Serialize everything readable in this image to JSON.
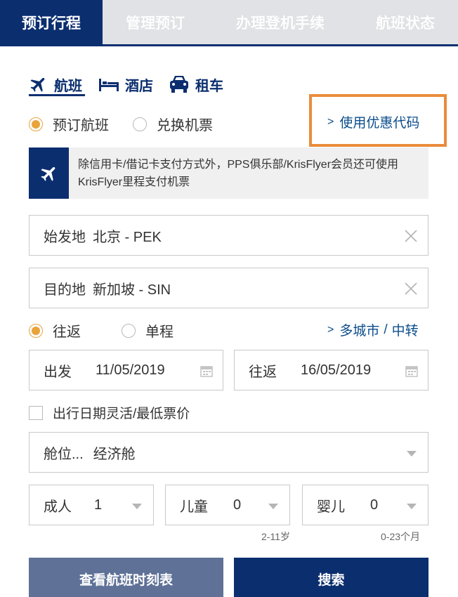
{
  "topnav": {
    "tabs": [
      {
        "label": "预订行程"
      },
      {
        "label": "管理预订"
      },
      {
        "label": "办理登机手续"
      },
      {
        "label": "航班状态"
      }
    ]
  },
  "products": {
    "flights": "航班",
    "hotels": "酒店",
    "cars": "租车"
  },
  "mode": {
    "book": "预订航班",
    "redeem": "兑换机票",
    "selected": "预订航班"
  },
  "promo": {
    "label": "使用优惠代码"
  },
  "info": {
    "text": "除信用卡/借记卡支付方式外，PPS俱乐部/KrisFlyer会员还可使用KrisFlyer里程支付机票"
  },
  "origin": {
    "label": "始发地",
    "value": "北京 - PEK"
  },
  "destination": {
    "label": "目的地",
    "value": "新加坡 - SIN"
  },
  "trip": {
    "round": "往返",
    "oneway": "单程",
    "selected": "往返",
    "multicity": "多城市",
    "stopover": "中转"
  },
  "dates": {
    "depart_label": "出发",
    "depart_value": "11/05/2019",
    "return_label": "往返",
    "return_value": "16/05/2019"
  },
  "flexible": {
    "label": "出行日期灵活/最低票价",
    "checked": false
  },
  "cabin": {
    "label": "舱位...",
    "value": "经济舱"
  },
  "passengers": {
    "adult_label": "成人",
    "adult_value": "1",
    "child_label": "儿童",
    "child_value": "0",
    "child_hint": "2-11岁",
    "infant_label": "婴儿",
    "infant_value": "0",
    "infant_hint": "0-23个月"
  },
  "buttons": {
    "schedule": "查看航班时刻表",
    "search": "搜索"
  },
  "colors": {
    "navy": "#0b2e6f",
    "accent": "#e9a33b",
    "promo_border": "#ea8c3b",
    "link": "#0b4d8c"
  }
}
